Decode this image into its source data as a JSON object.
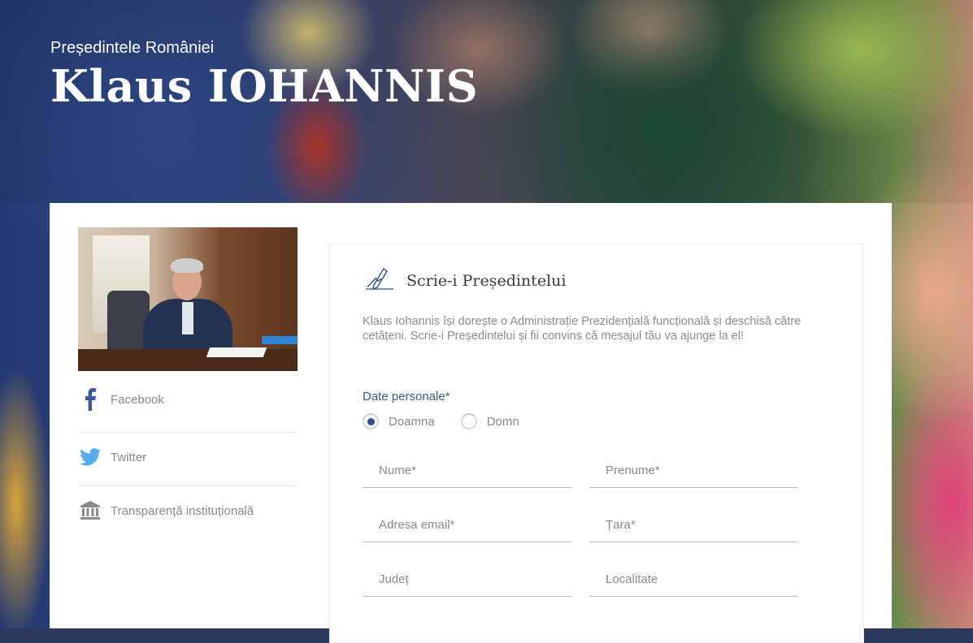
{
  "hero": {
    "subtitle": "Președintele României",
    "title": "Klaus IOHANNIS"
  },
  "sidebar": {
    "links": [
      {
        "label": "Facebook",
        "icon": "facebook-icon"
      },
      {
        "label": "Twitter",
        "icon": "twitter-icon"
      },
      {
        "label": "Transparență instituțională",
        "icon": "institution-icon"
      }
    ]
  },
  "form": {
    "icon": "signature-pen-icon",
    "title": "Scrie-i Președintelui",
    "intro": "Klaus Iohannis își dorește o Administrație Prezidențială funcțională și deschisă către cetățeni. Scrie-i Președintelui și fii convins că mesajul tău va ajunge la el!",
    "section_label": "Date personale",
    "required_mark": "*",
    "radio": [
      {
        "label": "Doamna",
        "selected": true
      },
      {
        "label": "Domn",
        "selected": false
      }
    ],
    "fields": {
      "nume": {
        "placeholder": "Nume*",
        "value": ""
      },
      "prenume": {
        "placeholder": "Prenume*",
        "value": ""
      },
      "email": {
        "placeholder": "Adresa email*",
        "value": ""
      },
      "tara": {
        "placeholder": "Țara*",
        "value": ""
      },
      "judet": {
        "placeholder": "Județ",
        "value": ""
      },
      "localitate": {
        "placeholder": "Localitate",
        "value": ""
      }
    }
  },
  "colors": {
    "accent": "#2d4f86",
    "label_blue": "#3b5a86",
    "facebook": "#3b5998",
    "twitter": "#55acee",
    "muted_text": "#8a8a8a"
  }
}
